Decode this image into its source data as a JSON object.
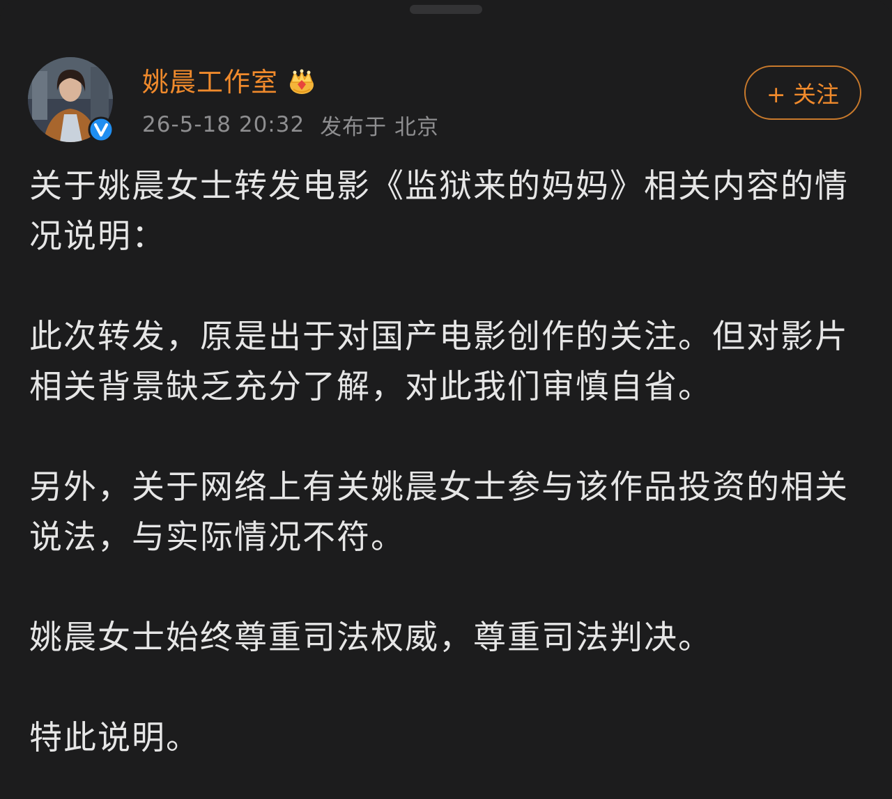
{
  "post": {
    "author_name": "姚晨工作室",
    "timestamp": "26-5-18 20:32",
    "location": "发布于 北京",
    "follow_label": "+ 关注",
    "badges": {
      "verified": "verified-v-badge-icon",
      "member": "crown-icon"
    },
    "paragraphs": [
      "关于姚晨女士转发电影《监狱来的妈妈》相关内容的情况说明：",
      "此次转发，原是出于对国产电影创作的关注。但对影片相关背景缺乏充分了解，对此我们审慎自省。",
      "另外，关于网络上有关姚晨女士参与该作品投资的相关说法，与实际情况不符。",
      "姚晨女士始终尊重司法权威，尊重司法判决。",
      "特此说明。"
    ]
  },
  "colors": {
    "background": "#1c1c1d",
    "accent": "#f08a2c",
    "text": "#e6e6e6",
    "muted": "#8e8e90",
    "verified": "#1f8ef1"
  }
}
